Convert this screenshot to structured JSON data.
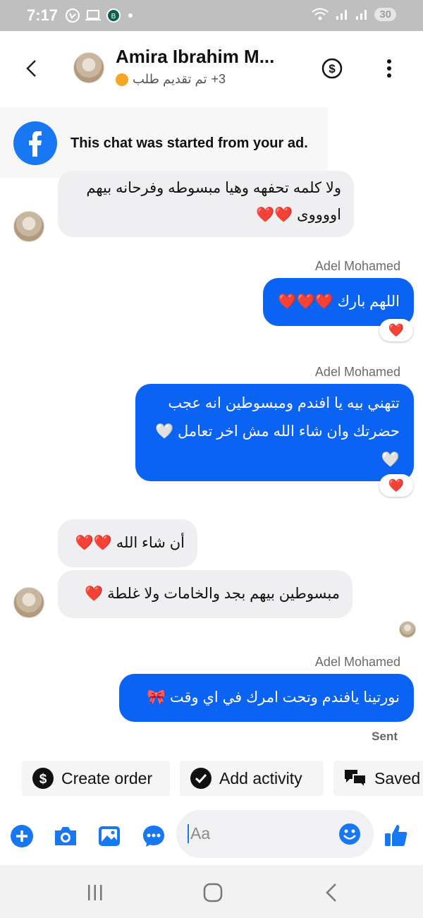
{
  "status_bar": {
    "time": "7:17",
    "battery": "30",
    "icons": [
      "whatsapp-icon",
      "laptop-icon",
      "whatsapp-business-icon",
      "dot-icon",
      "wifi-icon",
      "signal-icon",
      "signal-icon",
      "battery-icon"
    ]
  },
  "header": {
    "contact_name": "Amira Ibrahim M...",
    "plus_count": "+3",
    "status_label": "تم تقديم طلب",
    "status_color": "#f5a623"
  },
  "ad_banner": {
    "text": "This chat was started from your ad."
  },
  "messages": [
    {
      "direction": "in",
      "lines": [
        "ولا كلمه تحفهه وهيا مبسوطه وفرحانه بيهم",
        "اووووى ❤️❤️"
      ]
    },
    {
      "direction": "out",
      "sender": "Adel Mohamed",
      "lines": [
        "اللهم بارك ❤️❤️❤️"
      ],
      "reaction": "❤️"
    },
    {
      "direction": "out",
      "sender": "Adel Mohamed",
      "lines": [
        "تتهني بيه يا افندم ومبسوطين انه عجب",
        "حضرتك وان شاء الله مش اخر تعامل 🤍",
        "🤍"
      ],
      "reaction": "❤️"
    },
    {
      "direction": "in",
      "lines": [
        "أن شاء الله ❤️❤️"
      ]
    },
    {
      "direction": "in",
      "lines": [
        "مبسوطين بيهم بجد والخامات ولا غلطة ❤️"
      ]
    },
    {
      "direction": "out",
      "sender": "Adel Mohamed",
      "lines": [
        "نورتينا  يافندم وتحت امرك في اي وقت 🎀"
      ]
    }
  ],
  "sent_label": "Sent",
  "actions": {
    "create_order": "Create order",
    "add_activity": "Add activity",
    "saved": "Saved"
  },
  "composer": {
    "placeholder": "Aa"
  },
  "colors": {
    "accent": "#1877f2",
    "outgoing_bubble": "#0a63f2",
    "incoming_bubble": "#efeff1"
  }
}
